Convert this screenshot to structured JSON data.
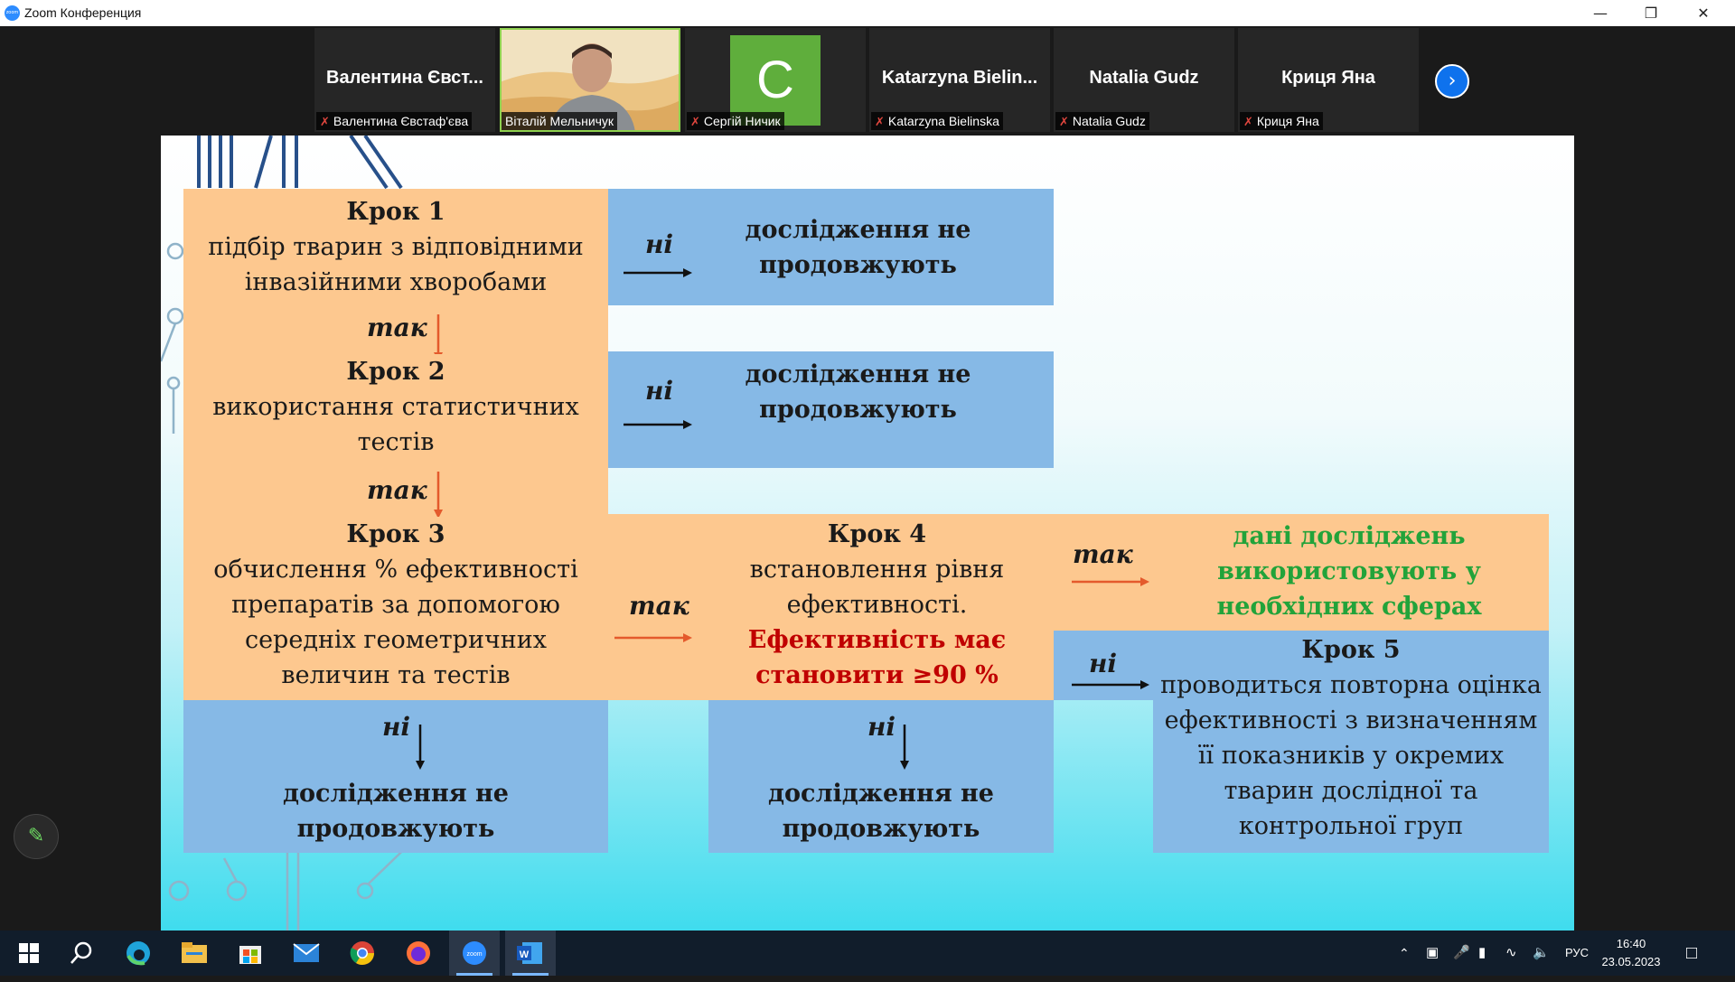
{
  "window": {
    "title": "Zoom Конференция",
    "app_logo": "zoom"
  },
  "gallery": {
    "tiles": [
      {
        "big": "Валентина Євст...",
        "label": "Валентина Євстаф'єва",
        "muted": true
      },
      {
        "big": "",
        "label": "Віталій Мельничук",
        "muted": false,
        "video": true
      },
      {
        "big": "",
        "avatar_letter": "C",
        "label": "Сергій Ничик",
        "muted": true
      },
      {
        "big": "Katarzyna  Bielin...",
        "label": "Katarzyna Bielinska",
        "muted": true
      },
      {
        "big": "Natalia Gudz",
        "label": "Natalia Gudz",
        "muted": true
      },
      {
        "big": "Криця Яна",
        "label": "Криця Яна",
        "muted": true
      }
    ],
    "next_icon": "chevron-right-icon"
  },
  "slide": {
    "step1": {
      "title": "Крок 1",
      "text": "підбір тварин з відповідними інвазійними хворобами"
    },
    "step2": {
      "title": "Крок 2",
      "text": "використання статистичних тестів"
    },
    "step3": {
      "title": "Крок 3",
      "text": "обчислення % ефективності препаратів за допомогою середніх геометричних величин та тестів"
    },
    "step4": {
      "title": "Крок 4",
      "text": "встановлення рівня ефективності.",
      "highlight": "Ефективність має становити ≥90 %"
    },
    "step5": {
      "title": "Крок 5",
      "text": "проводиться повторна оцінка ефективності з визначенням її показників у окремих тварин дослідної та контрольної груп"
    },
    "stop_text": "дослідження не продовжують",
    "success_text": "дані досліджень використовують у необхідних сферах",
    "yes": "так",
    "no": "ні"
  },
  "taskbar": {
    "language": "РУС",
    "time": "16:40",
    "date": "23.05.2023"
  },
  "colors": {
    "orange": "#fdc88f",
    "blue": "#86b9e6",
    "red": "#c00000",
    "green": "#22a33a",
    "zoom_blue": "#2d8cff"
  }
}
